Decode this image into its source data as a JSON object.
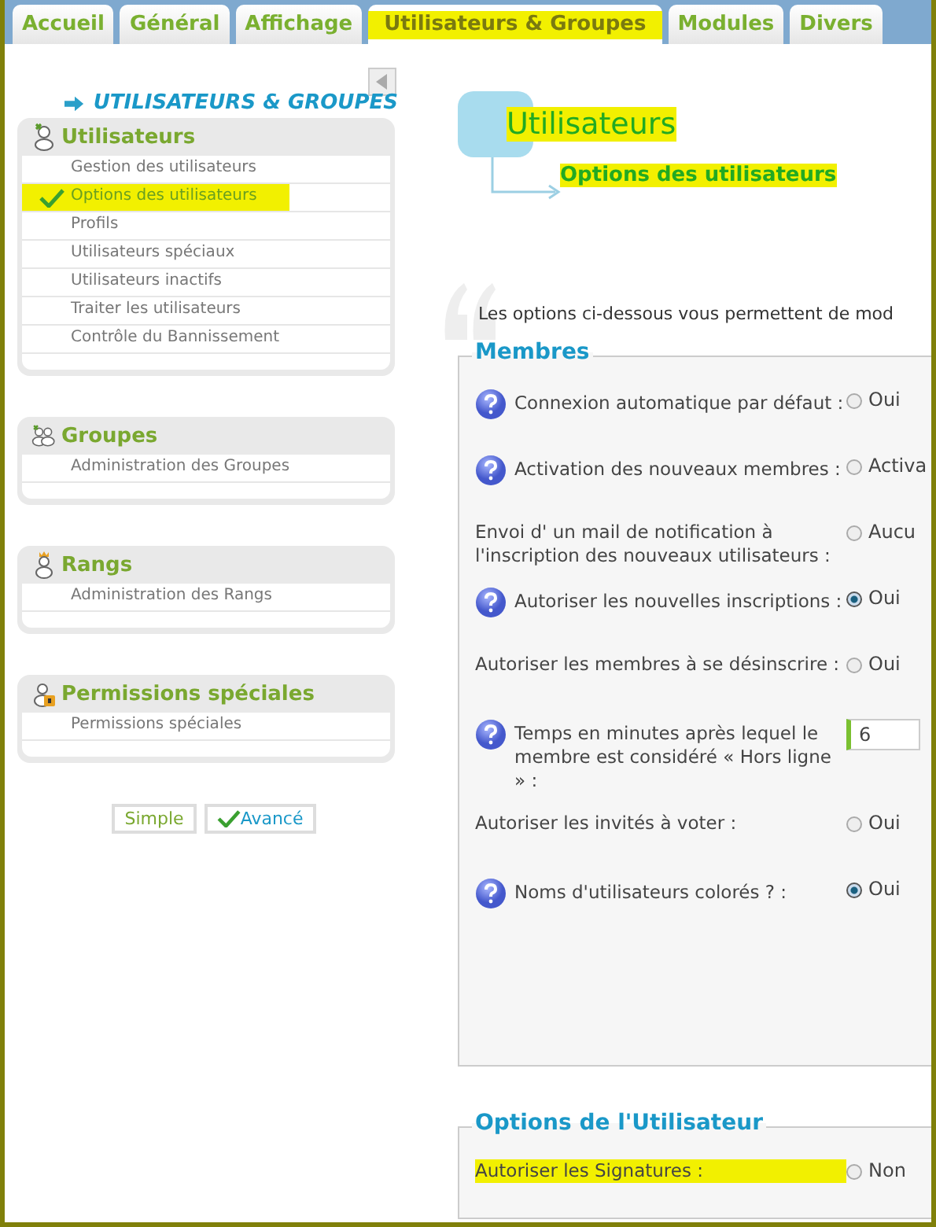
{
  "tabs": [
    {
      "label": "Accueil",
      "selected": false,
      "highlighted": false
    },
    {
      "label": "Général",
      "selected": false,
      "highlighted": false
    },
    {
      "label": "Affichage",
      "selected": false,
      "highlighted": false
    },
    {
      "label": "Utilisateurs & Groupes",
      "selected": true,
      "highlighted": true
    },
    {
      "label": "Modules",
      "selected": false,
      "highlighted": false
    },
    {
      "label": "Divers",
      "selected": false,
      "highlighted": false
    }
  ],
  "sidebar": {
    "heading": "UTILISATEURS & GROUPES",
    "sections": [
      {
        "title": "Utilisateurs",
        "items": [
          {
            "label": "Gestion des utilisateurs",
            "selected": false,
            "highlighted": false
          },
          {
            "label": "Options des utilisateurs",
            "selected": true,
            "highlighted": true
          },
          {
            "label": "Profils",
            "selected": false,
            "highlighted": false
          },
          {
            "label": "Utilisateurs spéciaux",
            "selected": false,
            "highlighted": false
          },
          {
            "label": "Utilisateurs inactifs",
            "selected": false,
            "highlighted": false
          },
          {
            "label": "Traiter les utilisateurs",
            "selected": false,
            "highlighted": false
          },
          {
            "label": "Contrôle du Bannissement",
            "selected": false,
            "highlighted": false
          }
        ]
      },
      {
        "title": "Groupes",
        "items": [
          {
            "label": "Administration des Groupes",
            "selected": false,
            "highlighted": false
          }
        ]
      },
      {
        "title": "Rangs",
        "items": [
          {
            "label": "Administration des Rangs",
            "selected": false,
            "highlighted": false
          }
        ]
      },
      {
        "title": "Permissions spéciales",
        "items": [
          {
            "label": "Permissions spéciales",
            "selected": false,
            "highlighted": false
          }
        ]
      }
    ],
    "modes": [
      {
        "label": "Simple",
        "selected": false
      },
      {
        "label": "Avancé",
        "selected": true
      }
    ]
  },
  "page": {
    "title": "Utilisateurs",
    "title_highlighted": true,
    "subtitle": "Options des utilisateurs",
    "subtitle_highlighted": true,
    "intro": "Les options ci-dessous vous permettent de mod"
  },
  "fieldsets": [
    {
      "legend": "Membres",
      "rows": [
        {
          "label": "Connexion automatique par défaut :",
          "help": true,
          "kind": "radio",
          "option": "Oui",
          "selected": false,
          "highlighted": false
        },
        {
          "label": "Activation des nouveaux membres :",
          "help": true,
          "kind": "radio",
          "option": "Activa",
          "selected": false,
          "highlighted": false
        },
        {
          "label": "Envoi d' un mail de notification à l'inscription des nouveaux utilisateurs :",
          "help": false,
          "kind": "radio",
          "option": "Aucu",
          "selected": false,
          "highlighted": false
        },
        {
          "label": "Autoriser les nouvelles inscriptions :",
          "help": true,
          "kind": "radio",
          "option": "Oui",
          "selected": true,
          "highlighted": false
        },
        {
          "label": "Autoriser les membres à se désinscrire :",
          "help": false,
          "kind": "radio",
          "option": "Oui",
          "selected": false,
          "highlighted": false
        },
        {
          "label": "Temps en minutes après lequel le membre est considéré « Hors ligne » :",
          "help": true,
          "kind": "text",
          "value": "6",
          "highlighted": false
        },
        {
          "label": "Autoriser les invités à voter :",
          "help": false,
          "kind": "radio",
          "option": "Oui",
          "selected": false,
          "highlighted": false
        },
        {
          "label": "Noms d'utilisateurs colorés ? :",
          "help": true,
          "kind": "radio",
          "option": "Oui",
          "selected": true,
          "highlighted": false
        }
      ]
    },
    {
      "legend": "Options de l'Utilisateur",
      "rows": [
        {
          "label": "Autoriser les Signatures :",
          "help": false,
          "kind": "radio",
          "option": "Non",
          "selected": false,
          "highlighted": true
        }
      ]
    }
  ]
}
